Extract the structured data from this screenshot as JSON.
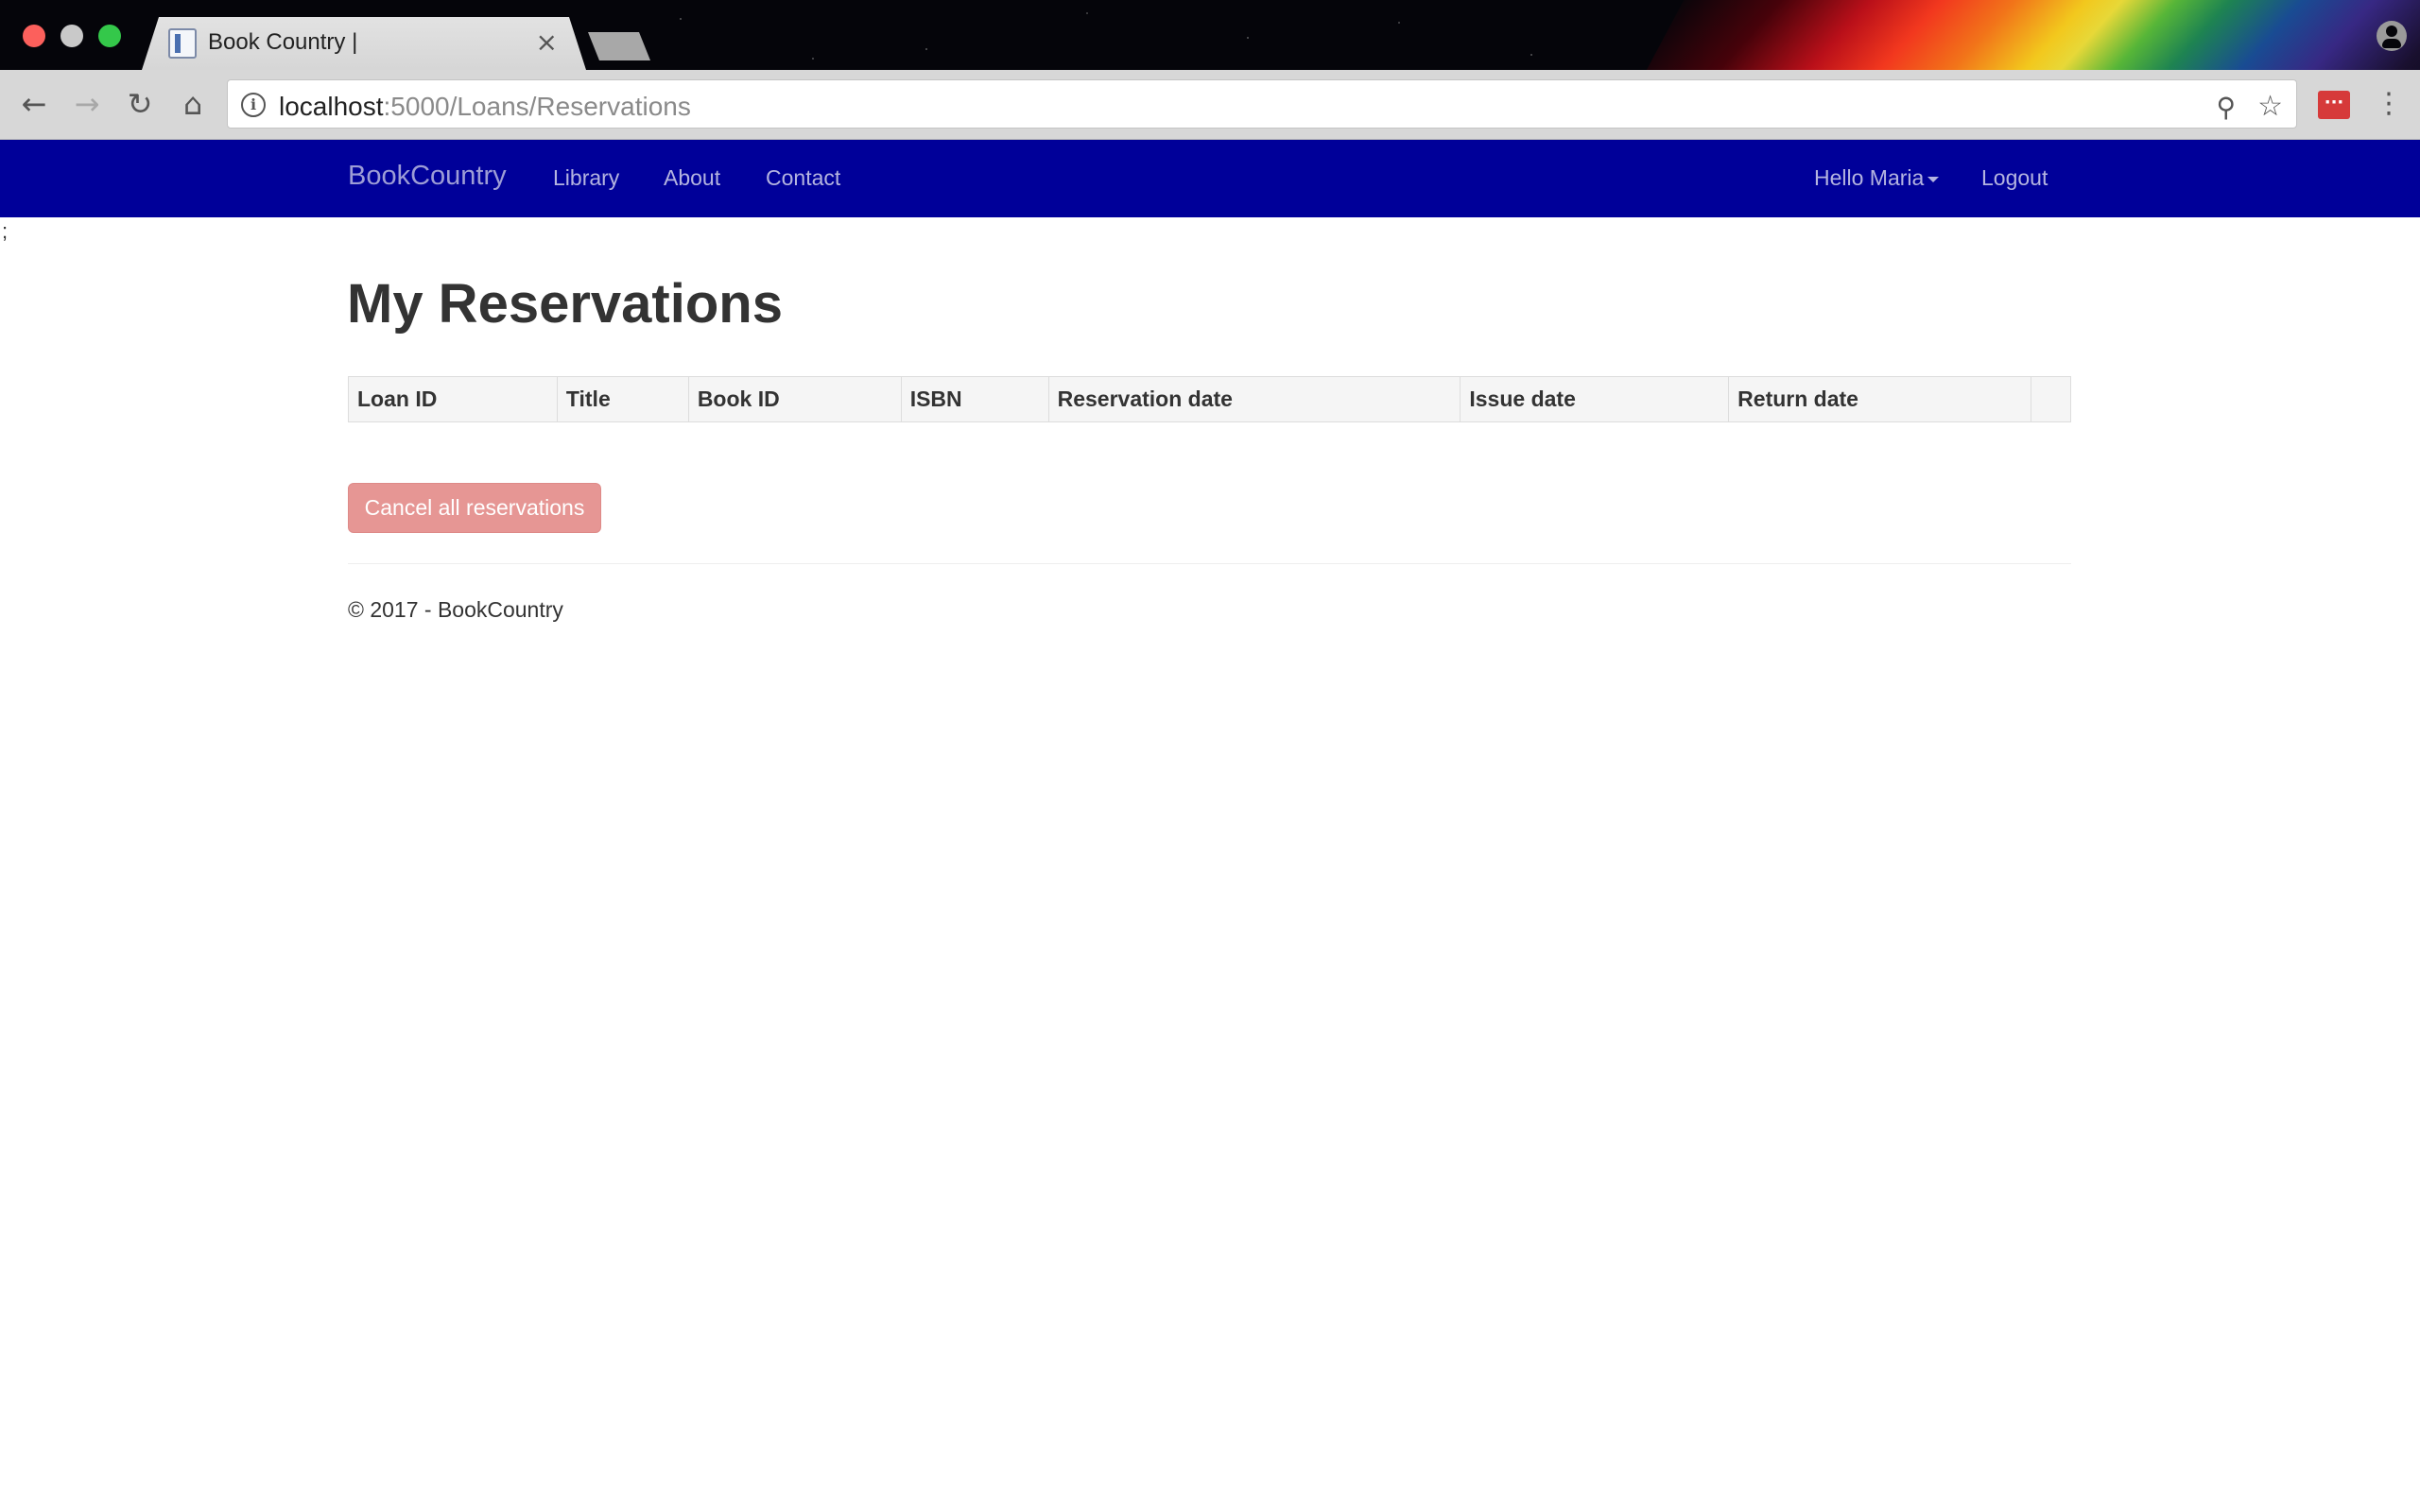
{
  "browser": {
    "tab_title": "Book Country |",
    "tab_close": "×",
    "url_host": "localhost",
    "url_rest": ":5000/Loans/Reservations",
    "icons": {
      "back": "back-arrow-icon",
      "forward": "forward-arrow-icon",
      "reload": "reload-icon",
      "home": "home-icon",
      "info": "info-icon",
      "zoom": "zoom-out-icon",
      "star": "bookmark-star-icon",
      "extension": "extension-icon",
      "menu": "menu-dots-icon",
      "profile": "profile-icon"
    }
  },
  "navbar": {
    "brand": "BookCountry",
    "links": [
      "Library",
      "About",
      "Contact"
    ],
    "user_greeting": "Hello Maria",
    "logout": "Logout",
    "background": "#000099"
  },
  "stray_text": ";",
  "main": {
    "title": "My Reservations",
    "table": {
      "columns": [
        "Loan ID",
        "Title",
        "Book ID",
        "ISBN",
        "Reservation date",
        "Issue date",
        "Return date",
        ""
      ],
      "rows": []
    },
    "cancel_button": "Cancel all reservations",
    "cancel_button_color": "#e69694"
  },
  "footer": {
    "text": "© 2017 - BookCountry"
  }
}
